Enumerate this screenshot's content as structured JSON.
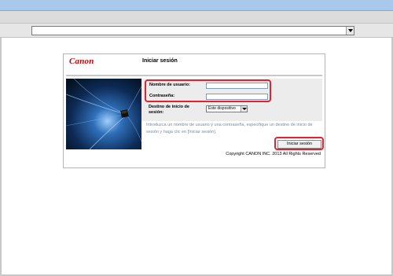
{
  "browser": {
    "address_value": ""
  },
  "login": {
    "logo_text": "Canon",
    "title": "Iniciar sesión",
    "username_label": "Nombre de usuario:",
    "username_value": "",
    "password_label": "Contraseña:",
    "password_value": "",
    "destination_label": "Destino de inicio de sesión:",
    "destination_selected": "Este dispositivo",
    "hint": "Introduzca un nombre de usuario y una contraseña, especifique un destino de inicio de sesión y haga clic en [Iniciar sesión].",
    "login_button": "Iniciar sesión",
    "copyright": "Copyright CANON INC. 2013 All Rights Reserved"
  },
  "colors": {
    "brand_red": "#cc0000",
    "highlight_red": "#e2222e",
    "hint_text": "#7c8aa8"
  }
}
